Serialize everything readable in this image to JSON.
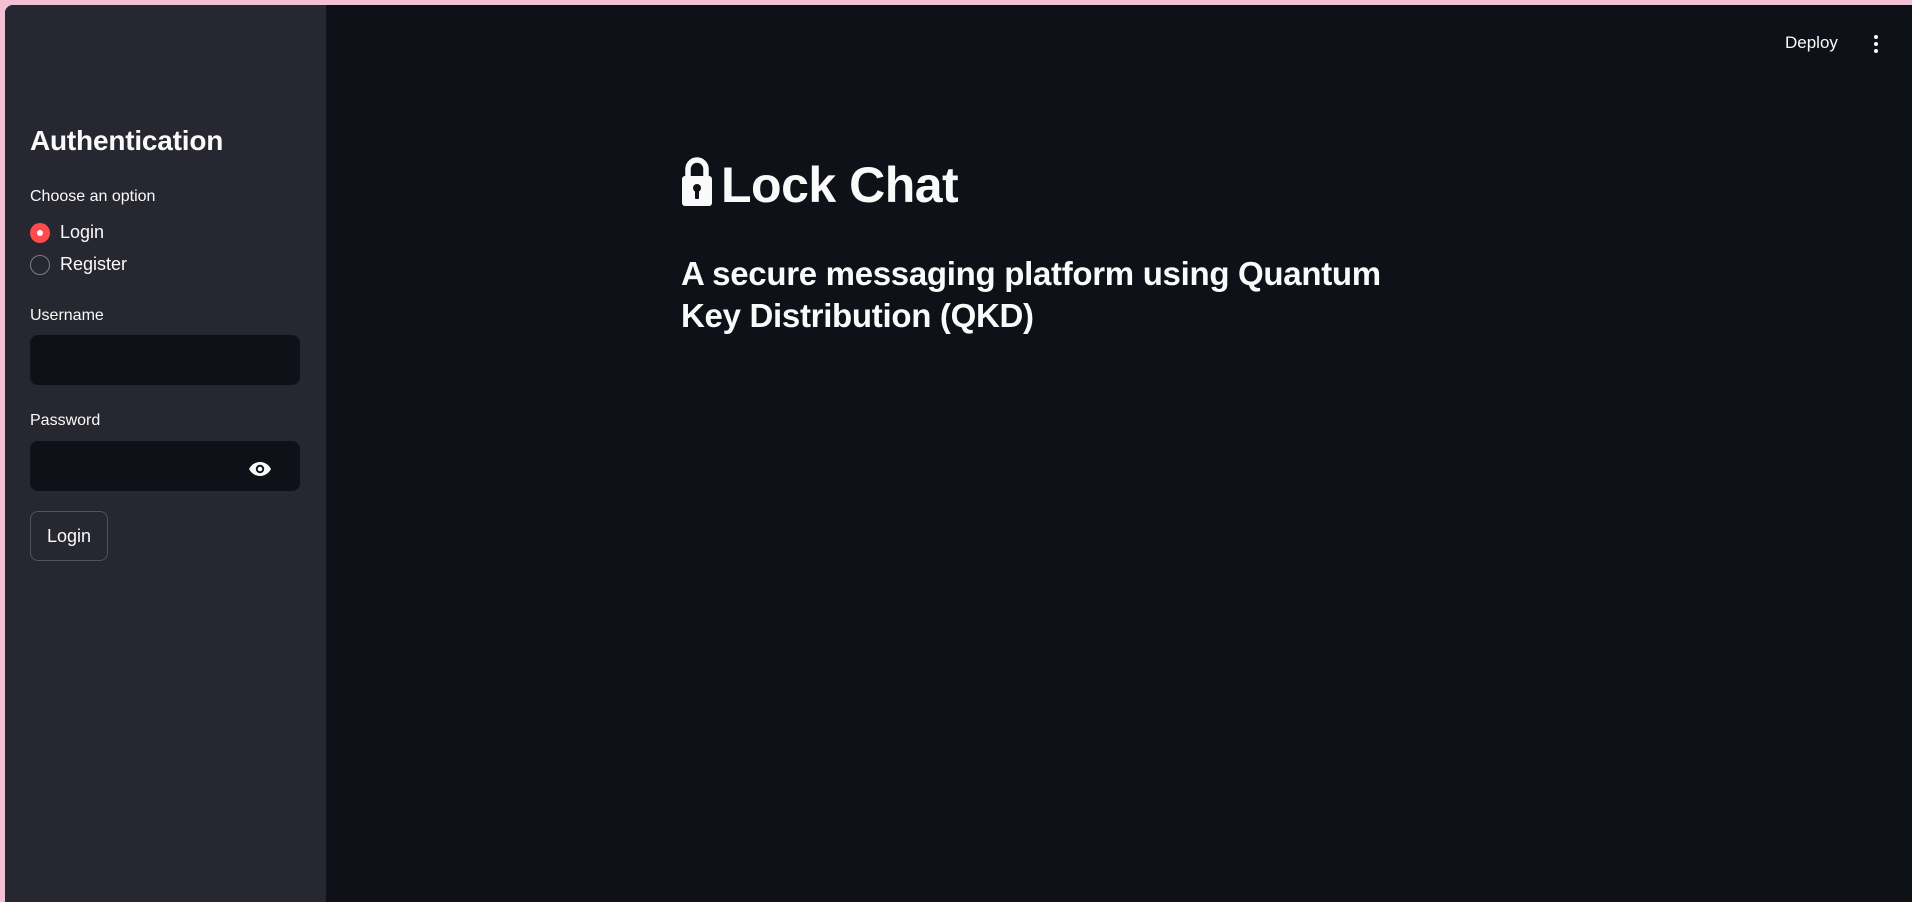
{
  "header": {
    "deploy_label": "Deploy",
    "menu_icon": "kebab-menu-icon"
  },
  "sidebar": {
    "title": "Authentication",
    "option_label": "Choose an option",
    "options": [
      {
        "label": "Login",
        "selected": true
      },
      {
        "label": "Register",
        "selected": false
      }
    ],
    "username_label": "Username",
    "username_value": "",
    "password_label": "Password",
    "password_value": "",
    "password_toggle_icon": "eye-icon",
    "submit_label": "Login"
  },
  "main": {
    "title_icon": "lock-icon",
    "title": "Lock Chat",
    "subtitle": "A secure messaging platform using Quantum Key Distribution (QKD)"
  },
  "colors": {
    "accent": "#ff4b4b",
    "background": "#0e1117",
    "sidebar": "#262730",
    "text": "#fafafa",
    "frame": "#f4c1d4"
  }
}
